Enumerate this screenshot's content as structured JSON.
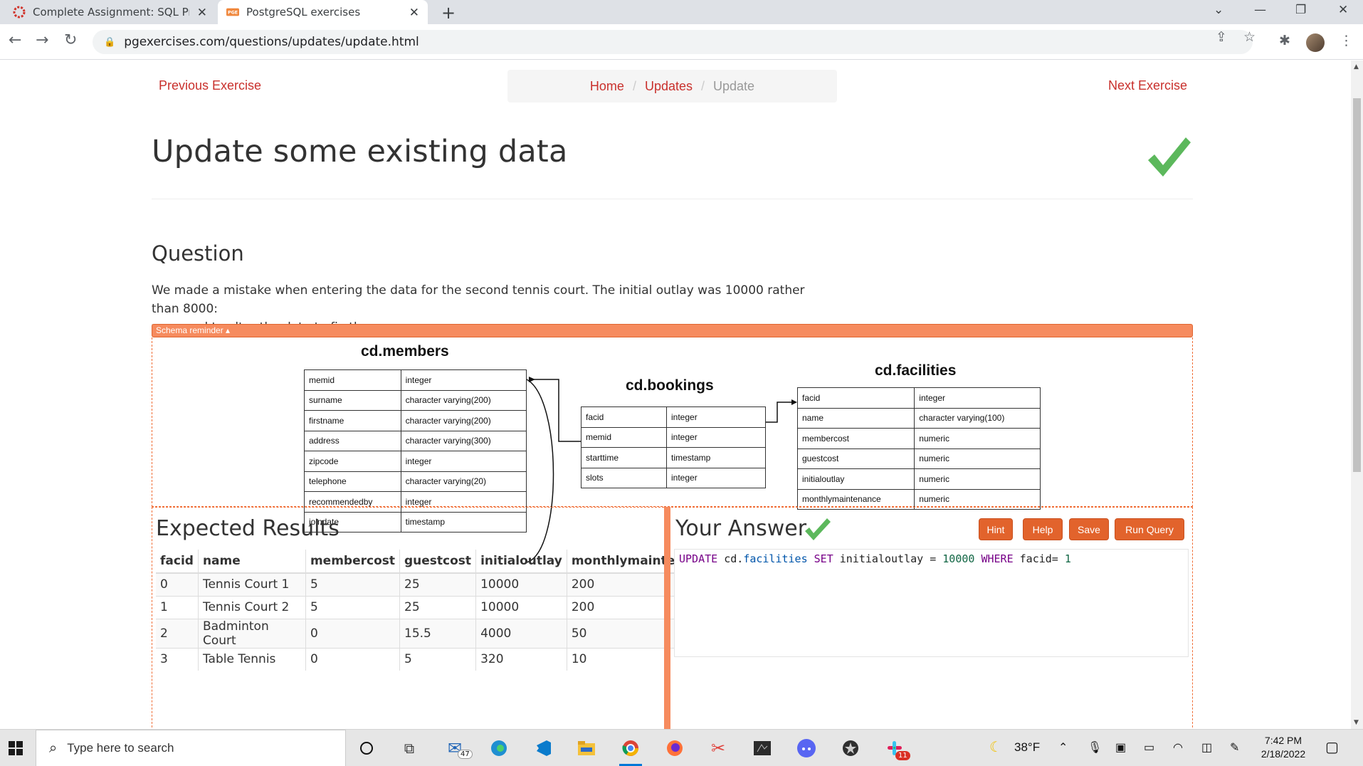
{
  "browser": {
    "tabs": [
      {
        "title": "Complete Assignment: SQL Practi",
        "active": false
      },
      {
        "title": "PostgreSQL exercises",
        "active": true
      }
    ],
    "url": "pgexercises.com/questions/updates/update.html"
  },
  "nav": {
    "prev_label": "Previous Exercise",
    "next_label": "Next Exercise",
    "breadcrumb": [
      "Home",
      "Updates",
      "Update"
    ]
  },
  "page": {
    "title": "Update some existing data",
    "question_heading": "Question",
    "question_text_1": "We made a mistake when entering the data for the second tennis court. The initial outlay was 10000 rather than 8000:",
    "question_text_2": "you need to alter the data to fix the error.",
    "schema_toggle": "Schema reminder ▴"
  },
  "schema": {
    "members": {
      "title": "cd.members",
      "rows": [
        [
          "memid",
          "integer"
        ],
        [
          "surname",
          "character varying(200)"
        ],
        [
          "firstname",
          "character varying(200)"
        ],
        [
          "address",
          "character varying(300)"
        ],
        [
          "zipcode",
          "integer"
        ],
        [
          "telephone",
          "character varying(20)"
        ],
        [
          "recommendedby",
          "integer"
        ],
        [
          "joindate",
          "timestamp"
        ]
      ]
    },
    "bookings": {
      "title": "cd.bookings",
      "rows": [
        [
          "facid",
          "integer"
        ],
        [
          "memid",
          "integer"
        ],
        [
          "starttime",
          "timestamp"
        ],
        [
          "slots",
          "integer"
        ]
      ]
    },
    "facilities": {
      "title": "cd.facilities",
      "rows": [
        [
          "facid",
          "integer"
        ],
        [
          "name",
          "character varying(100)"
        ],
        [
          "membercost",
          "numeric"
        ],
        [
          "guestcost",
          "numeric"
        ],
        [
          "initialoutlay",
          "numeric"
        ],
        [
          "monthlymaintenance",
          "numeric"
        ]
      ]
    }
  },
  "expected": {
    "heading": "Expected Results",
    "columns": [
      "facid",
      "name",
      "membercost",
      "guestcost",
      "initialoutlay",
      "monthlymaintenance"
    ],
    "rows": [
      [
        "0",
        "Tennis Court 1",
        "5",
        "25",
        "10000",
        "200"
      ],
      [
        "1",
        "Tennis Court 2",
        "5",
        "25",
        "10000",
        "200"
      ],
      [
        "2",
        "Badminton Court",
        "0",
        "15.5",
        "4000",
        "50"
      ],
      [
        "3",
        "Table Tennis",
        "0",
        "5",
        "320",
        "10"
      ]
    ]
  },
  "answer": {
    "heading": "Your Answer",
    "buttons": {
      "hint": "Hint",
      "help": "Help",
      "save": "Save",
      "run": "Run Query"
    },
    "code": {
      "kw1": "UPDATE",
      "schema_prefix": " cd.",
      "table": "facilities",
      "kw2": " SET ",
      "col1": "initialoutlay = ",
      "val1": "10000",
      "kw3": " WHERE ",
      "col2": "facid= ",
      "val2": "1"
    }
  },
  "taskbar": {
    "search_placeholder": "Type here to search",
    "mail_badge": "47",
    "slack_badge": "11",
    "weather": "38°F",
    "time": "7:42 PM",
    "date": "2/18/2022"
  },
  "colors": {
    "accent_orange": "#f68b5e",
    "button_orange": "#e2632c",
    "link_red": "#c9302c",
    "check_green": "#5cb85c"
  }
}
